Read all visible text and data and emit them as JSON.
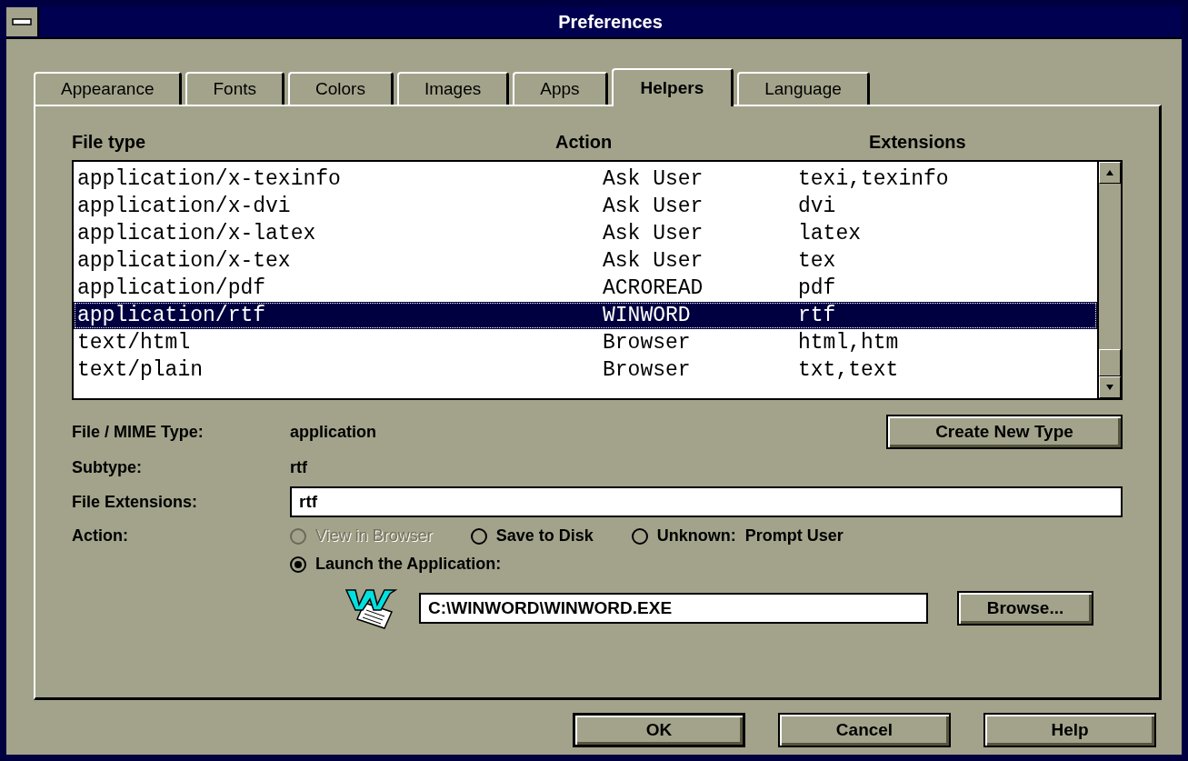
{
  "window": {
    "title": "Preferences"
  },
  "tabs": [
    {
      "label": "Appearance",
      "selected": false
    },
    {
      "label": "Fonts",
      "selected": false
    },
    {
      "label": "Colors",
      "selected": false
    },
    {
      "label": "Images",
      "selected": false
    },
    {
      "label": "Apps",
      "selected": false
    },
    {
      "label": "Helpers",
      "selected": true
    },
    {
      "label": "Language",
      "selected": false
    }
  ],
  "table": {
    "columns": [
      "File type",
      "Action",
      "Extensions"
    ],
    "rows": [
      {
        "cells": [
          "application/x-texinfo",
          "Ask User",
          "texi,texinfo"
        ],
        "selected": false
      },
      {
        "cells": [
          "application/x-dvi",
          "Ask User",
          "dvi"
        ],
        "selected": false
      },
      {
        "cells": [
          "application/x-latex",
          "Ask User",
          "latex"
        ],
        "selected": false
      },
      {
        "cells": [
          "application/x-tex",
          "Ask User",
          "tex"
        ],
        "selected": false
      },
      {
        "cells": [
          "application/pdf",
          "ACROREAD",
          "pdf"
        ],
        "selected": false
      },
      {
        "cells": [
          "application/rtf",
          "WINWORD",
          "rtf"
        ],
        "selected": true
      },
      {
        "cells": [
          "text/html",
          "Browser",
          "html,htm"
        ],
        "selected": false
      },
      {
        "cells": [
          "text/plain",
          "Browser",
          "txt,text"
        ],
        "selected": false
      }
    ]
  },
  "details": {
    "mime_label": "File / MIME Type:",
    "mime_value": "application",
    "create_button": "Create New Type",
    "subtype_label": "Subtype:",
    "subtype_value": "rtf",
    "extensions_label": "File Extensions:",
    "extensions_value": "rtf",
    "action_label": "Action:"
  },
  "actions": [
    {
      "label": "View in Browser",
      "selected": false,
      "disabled": true
    },
    {
      "label": "Save to Disk",
      "selected": false,
      "disabled": false
    },
    {
      "label": "Unknown:",
      "selected": false,
      "disabled": false,
      "extra": "Prompt User"
    },
    {
      "label": "Launch the Application:",
      "selected": true,
      "disabled": false
    }
  ],
  "application": {
    "path": "C:\\WINWORD\\WINWORD.EXE",
    "browse_button": "Browse..."
  },
  "buttons": [
    "OK",
    "Cancel",
    "Help"
  ]
}
